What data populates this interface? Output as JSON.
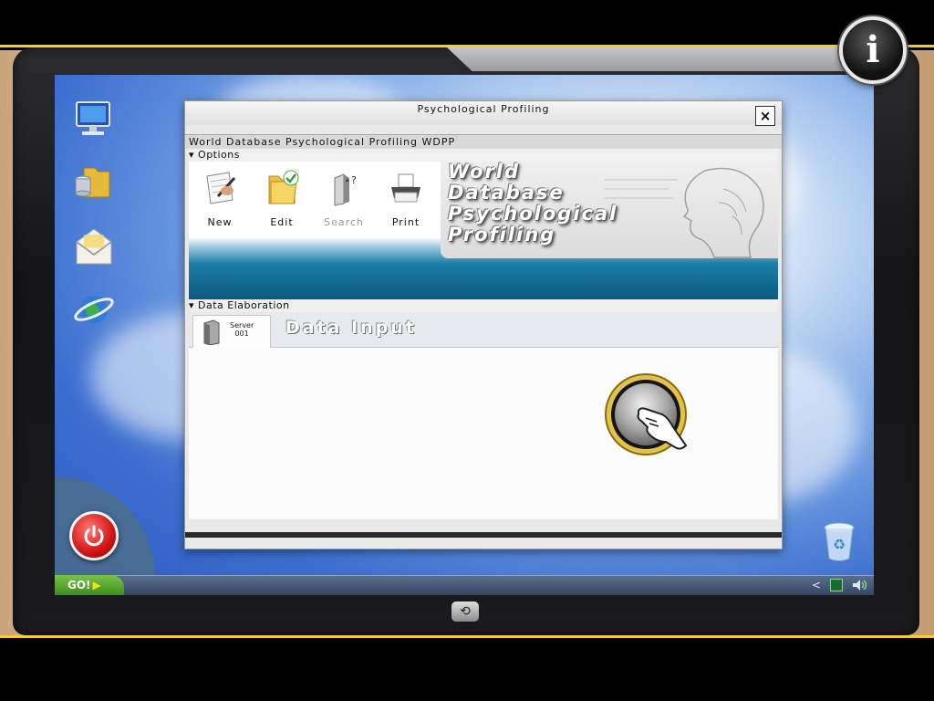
{
  "window": {
    "title": "Psychological Profiling",
    "close_label": "×",
    "subtitle": "World Database Psychological Profiling  WDPP"
  },
  "options": {
    "section_label": "Options",
    "tools": [
      {
        "label": "New",
        "icon": "new-document-pen-icon",
        "enabled": true
      },
      {
        "label": "Edit",
        "icon": "folder-check-icon",
        "enabled": true
      },
      {
        "label": "Search",
        "icon": "search-document-icon",
        "enabled": false
      },
      {
        "label": "Print",
        "icon": "printer-icon",
        "enabled": true
      }
    ],
    "banner_lines": [
      "World",
      "Database",
      "Psychological",
      "Profiling"
    ]
  },
  "data_elaboration": {
    "section_label": "Data Elaboration",
    "server_tab": {
      "line1": "Server",
      "line2": "001"
    },
    "title": "Data Input"
  },
  "taskbar": {
    "go_label": "GO!",
    "go_arrow": "▶",
    "tray_left": "<"
  },
  "info_button": {
    "label": "i"
  },
  "colors": {
    "accent_yellow": "#f2cf2a",
    "window_bg": "#e9e9ea",
    "teal_band": "#0b5a80",
    "power_red": "#d21414",
    "go_green": "#3d8d1c"
  }
}
